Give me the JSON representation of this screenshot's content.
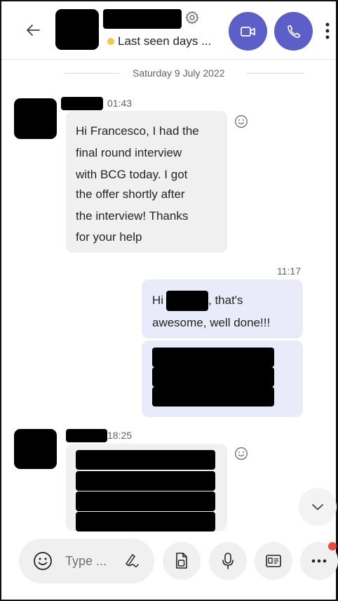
{
  "header": {
    "status_text": "Last seen days ...",
    "status_color": "#f2c94c",
    "accent": "#5b5fc7"
  },
  "date_divider": "Saturday 9 July 2022",
  "messages": [
    {
      "direction": "incoming",
      "time": "01:43",
      "lines": [
        "Hi Francesco, I had the",
        "final round interview",
        "with BCG today. I got",
        "the offer shortly after",
        "the interview! Thanks",
        "for your help"
      ]
    },
    {
      "direction": "outgoing",
      "time": "11:17",
      "lines": [
        "Hi",
        ", that's",
        "awesome, well done!!!"
      ]
    },
    {
      "direction": "incoming",
      "time": "18:25",
      "lines": []
    }
  ],
  "composer": {
    "placeholder": "Type ..."
  },
  "icons": {
    "back": "back-arrow-icon",
    "settings": "gear-icon",
    "video": "video-camera-icon",
    "call": "phone-icon",
    "more": "more-vertical-icon",
    "emoji": "emoji-icon",
    "format": "format-pen-icon",
    "attach": "attach-file-icon",
    "mic": "microphone-icon",
    "card": "contact-card-icon",
    "more_h": "more-horizontal-icon",
    "scroll_down": "chevron-down-icon"
  },
  "notification_dot_color": "#e74c3c"
}
